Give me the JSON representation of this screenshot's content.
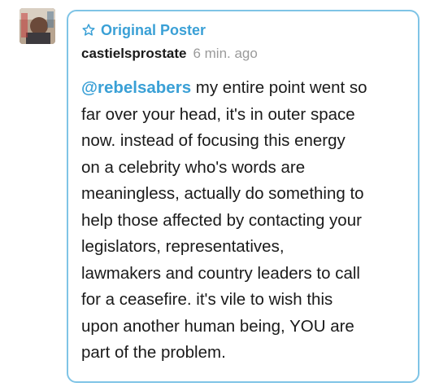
{
  "avatar": {
    "alt": "user avatar"
  },
  "post": {
    "badge_label": "Original Poster",
    "badge_icon": "star-outline-icon",
    "username": "castielsprostate",
    "timestamp": "6 min. ago",
    "mention": "@rebelsabers",
    "lines": [
      " my entire point went so",
      "far over your head, it's in outer space",
      "now. instead of focusing this energy",
      "on a celebrity who's words are",
      "meaningless, actually do something to",
      "help those affected by contacting your",
      "legislators, representatives,",
      "lawmakers and country leaders to call",
      "for a ceasefire. it's vile to wish this",
      "upon another human being, YOU are",
      "part of the problem."
    ]
  },
  "colors": {
    "accent": "#3aa0d6",
    "card_border": "#7fc4e6",
    "text": "#1a1a1a",
    "muted": "#9a9a9a"
  }
}
